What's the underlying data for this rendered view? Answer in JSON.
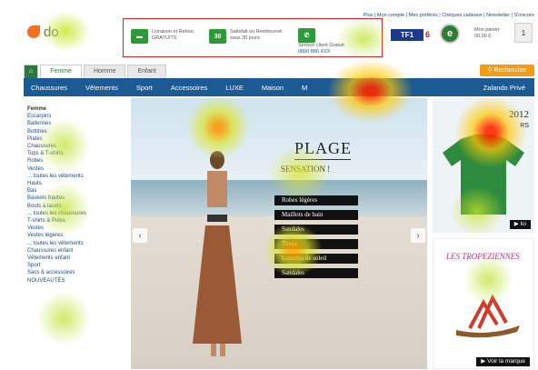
{
  "header": {
    "top_links": "Plus | Mon compte | Mes préférés | Chèques cadeaux | Newsletter | S'inscrire",
    "logo_text": "do",
    "promo": {
      "delivery": "Livraison et Retour GRATUITS",
      "thirty": "30",
      "thirty_text": "Satisfait ou Remboursé sous 30 jours",
      "service": "Service client Gratuit",
      "phone": "0800 880 XXX"
    },
    "tf1": "TF1",
    "m6": "6",
    "e_label": "e",
    "cart_title": "Mon panier",
    "cart_value": "00,00 €",
    "cart_count": "1"
  },
  "tabs": {
    "home": "⌂",
    "femme": "Femme",
    "homme": "Homme",
    "enfant": "Enfant"
  },
  "search_label": "Rechercher",
  "nav": {
    "items": [
      "Chaussures",
      "Vêtements",
      "Sport",
      "Accessoires",
      "LUXE",
      "Maison",
      "M"
    ],
    "right": "Zalando Privé"
  },
  "sidebar": {
    "items": [
      "Femme",
      "Escarpins",
      "Ballerines",
      "Bottines",
      "Plates",
      "Chaussures",
      "Tops & T-shirts",
      "Robes",
      "Vestes",
      "... toutes les vêtements",
      "Hauts",
      "Bas",
      "Baskets hautes",
      "Boots à lacets",
      "... toutes les chaussures",
      "T-shirts & Polos",
      "Vestes",
      "Vestes légères",
      "... toutes les vêtements",
      "Chaussures enfant",
      "Vêtements enfant",
      "Sport",
      "Sacs & accessoires",
      "NOUVEAUTÉS"
    ]
  },
  "hero": {
    "title": "PLAGE",
    "subtitle": "SENSATION !",
    "buttons": [
      "Robes légères",
      "Maillots de bain",
      "Sandales",
      "Tongs",
      "Lunettes de soleil",
      "Sandales"
    ]
  },
  "ad1": {
    "text": "2012",
    "text2": "RS",
    "button": "▶ Ici"
  },
  "ad2": {
    "title": "LES TROPEZIENNES",
    "button": "▶ Voir la marque"
  },
  "colors": {
    "nav": "#1c5a94",
    "accent": "#2c7a3a",
    "search": "#f39c12",
    "promo_border": "#dd2222"
  }
}
